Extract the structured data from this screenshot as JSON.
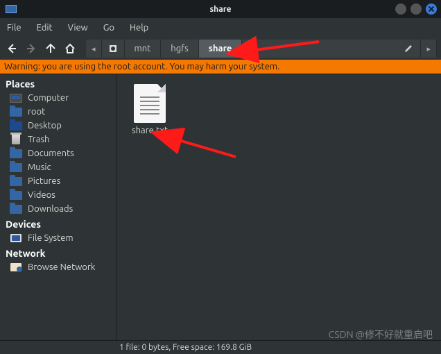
{
  "window": {
    "title": "share"
  },
  "menubar": [
    "File",
    "Edit",
    "View",
    "Go",
    "Help"
  ],
  "path": {
    "segments": [
      "mnt",
      "hgfs",
      "share"
    ],
    "active_index": 2
  },
  "warning": "Warning: you are using the root account. You may harm your system.",
  "sidebar": {
    "sections": [
      {
        "header": "Places",
        "items": [
          {
            "label": "Computer",
            "icon": "monitor-icon"
          },
          {
            "label": "root",
            "icon": "folder-icon"
          },
          {
            "label": "Desktop",
            "icon": "folder-dark-icon"
          },
          {
            "label": "Trash",
            "icon": "trash-icon"
          },
          {
            "label": "Documents",
            "icon": "folder-icon"
          },
          {
            "label": "Music",
            "icon": "folder-icon"
          },
          {
            "label": "Pictures",
            "icon": "folder-icon"
          },
          {
            "label": "Videos",
            "icon": "folder-icon"
          },
          {
            "label": "Downloads",
            "icon": "folder-icon"
          }
        ]
      },
      {
        "header": "Devices",
        "items": [
          {
            "label": "File System",
            "icon": "disk-icon"
          }
        ]
      },
      {
        "header": "Network",
        "items": [
          {
            "label": "Browse Network",
            "icon": "network-icon"
          }
        ]
      }
    ]
  },
  "files": [
    {
      "name": "share.txt",
      "type": "text"
    }
  ],
  "status": "1 file: 0 bytes, Free space: 169.8 GiB",
  "watermark": "CSDN @修不好就重启吧"
}
